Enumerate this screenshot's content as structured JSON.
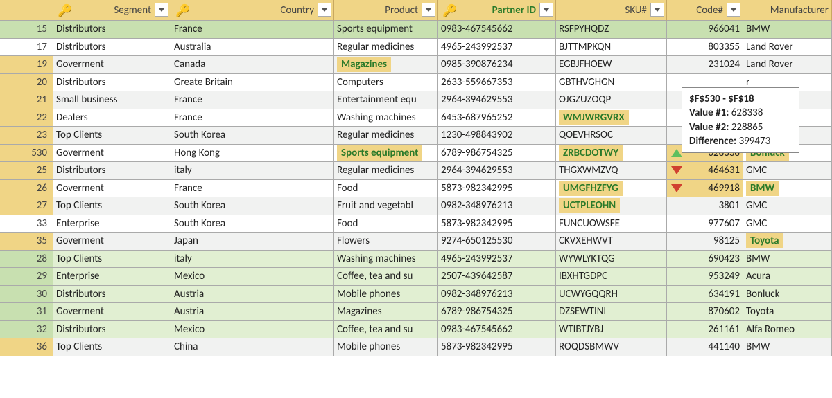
{
  "headers": {
    "segment": "Segment",
    "country": "Country",
    "product": "Product",
    "partnerId": "Partner ID",
    "sku": "SKU#",
    "code": "Code#",
    "manufacturer": "Manufacturer"
  },
  "rows": [
    {
      "n": "15",
      "seg": "Distributors",
      "cty": "France",
      "prd": "Sports equipment",
      "pid": "0983-467545662",
      "sku": "RSFPYHQDZ",
      "code": "966041",
      "mfr": "BMW",
      "rowBg": "bg-g",
      "nBg": "n-g"
    },
    {
      "n": "17",
      "seg": "Distributors",
      "cty": "Australia",
      "prd": "Regular medicines",
      "pid": "4965-243992537",
      "sku": "BJTTMPKQN",
      "code": "803355",
      "mfr": "Land Rover",
      "rowBg": "bg-w",
      "nBg": ""
    },
    {
      "n": "19",
      "seg": "Goverment",
      "cty": "Canada",
      "prd": "Magazines",
      "prdHl": true,
      "pid": "0985-390876234",
      "sku": "EGBJFHOEW",
      "code": "231024",
      "mfr": "Land Rover",
      "rowBg": "bg-gr",
      "nBg": "n-o"
    },
    {
      "n": "20",
      "seg": "Distributors",
      "cty": "Greate Britain",
      "prd": "Computers",
      "pid": "2633-559667353",
      "sku": "GBTHVGHGN",
      "code": "",
      "mfr": "r",
      "rowBg": "bg-w",
      "nBg": "n-o"
    },
    {
      "n": "21",
      "seg": "Small business",
      "cty": "France",
      "prd": "Entertainment equ",
      "pid": "2964-394629553",
      "sku": "OJGZUZOQP",
      "code": "",
      "mfr": "",
      "rowBg": "bg-gr",
      "nBg": "n-o"
    },
    {
      "n": "22",
      "seg": "Dealers",
      "cty": "France",
      "prd": "Washing machines",
      "pid": "6453-687965252",
      "sku": "WMJWRGVRX",
      "skuHl": true,
      "code": "",
      "mfr": "",
      "rowBg": "bg-w",
      "nBg": "n-o"
    },
    {
      "n": "23",
      "seg": "Top Clients",
      "cty": "South Korea",
      "prd": "Regular medicines",
      "pid": "1230-498843902",
      "sku": "QOEVHRSOC",
      "code": "",
      "mfr": "",
      "rowBg": "bg-gr",
      "nBg": "n-o"
    },
    {
      "n": "530",
      "seg": "Goverment",
      "cty": "Hong Kong",
      "prd": "Sports equipment",
      "prdHl": true,
      "pid": "6789-986754325",
      "sku": "ZRBCDOTWY",
      "skuHl": true,
      "code": "628338",
      "codeHl": "up",
      "mfr": "Bonluck",
      "mfrHl": true,
      "rowBg": "bg-w",
      "nBg": "n-o"
    },
    {
      "n": "25",
      "seg": "Distributors",
      "cty": "italy",
      "prd": "Regular medicines",
      "pid": "2964-394629553",
      "sku": "THGXWMZVQ",
      "code": "464631",
      "codeHl": "dn",
      "mfr": "GMC",
      "rowBg": "bg-gr",
      "nBg": "n-o"
    },
    {
      "n": "26",
      "seg": "Goverment",
      "cty": "France",
      "prd": "Food",
      "pid": "5873-982342995",
      "sku": "UMGFHZFYG",
      "skuHl": true,
      "code": "469918",
      "codeHl": "dn",
      "mfr": "BMW",
      "mfrHl": true,
      "rowBg": "bg-w",
      "nBg": "n-o"
    },
    {
      "n": "27",
      "seg": "Top Clients",
      "cty": "South Korea",
      "prd": "Fruit and vegetabl",
      "pid": "0982-348976213",
      "sku": "UCTPLEOHN",
      "skuHl": true,
      "code": "3801",
      "mfr": "GMC",
      "rowBg": "bg-gr",
      "nBg": "n-o"
    },
    {
      "n": "33",
      "seg": "Enterprise",
      "cty": "South Korea",
      "prd": "Food",
      "pid": "5873-982342995",
      "sku": "FUNCUOWSFE",
      "code": "977607",
      "mfr": "GMC",
      "rowBg": "bg-w",
      "nBg": ""
    },
    {
      "n": "35",
      "seg": "Goverment",
      "cty": "Japan",
      "prd": "Flowers",
      "pid": "9274-650125530",
      "sku": "CKVXEHWVT",
      "code": "98125",
      "mfr": "Toyota",
      "mfrHl": true,
      "rowBg": "bg-gr",
      "nBg": "n-o"
    },
    {
      "n": "28",
      "seg": "Top Clients",
      "cty": "italy",
      "prd": "Washing machines",
      "pid": "4965-243992537",
      "sku": "WYWLYKTQG",
      "code": "690423",
      "mfr": "BMW",
      "rowBg": "bg-lg",
      "nBg": "n-g"
    },
    {
      "n": "29",
      "seg": "Enterprise",
      "cty": "Mexico",
      "prd": "Coffee, tea and su",
      "pid": "2507-439642587",
      "sku": "IBXHTGDPC",
      "code": "953249",
      "mfr": "Acura",
      "rowBg": "bg-lg",
      "nBg": "n-g"
    },
    {
      "n": "30",
      "seg": "Distributors",
      "cty": "Austria",
      "prd": "Mobile phones",
      "pid": "0982-348976213",
      "sku": "UCWYGQQRH",
      "code": "634191",
      "mfr": "Bonluck",
      "rowBg": "bg-lg",
      "nBg": "n-g"
    },
    {
      "n": "31",
      "seg": "Goverment",
      "cty": "Austria",
      "prd": "Magazines",
      "pid": "6789-986754325",
      "sku": "DZSEWTINI",
      "code": "870602",
      "mfr": "Toyota",
      "rowBg": "bg-lg",
      "nBg": "n-g"
    },
    {
      "n": "32",
      "seg": "Distributors",
      "cty": "Mexico",
      "prd": "Coffee, tea and su",
      "pid": "0983-467545662",
      "sku": "WTIBTJYBJ",
      "code": "261161",
      "mfr": "Alfa Romeo",
      "rowBg": "bg-lg",
      "nBg": "n-g"
    },
    {
      "n": "36",
      "seg": "Top Clients",
      "cty": "China",
      "prd": "Mobile phones",
      "pid": "5873-982342995",
      "sku": "ROQDSBMWV",
      "code": "441140",
      "mfr": "BMW",
      "rowBg": "bg-gr",
      "nBg": "n-o"
    }
  ],
  "tooltip": {
    "title": "$F$530 - $F$18",
    "l1": "Value #1:",
    "v1": "628338",
    "l2": "Value #2:",
    "v2": "228865",
    "l3": "Difference:",
    "v3": "399473"
  }
}
